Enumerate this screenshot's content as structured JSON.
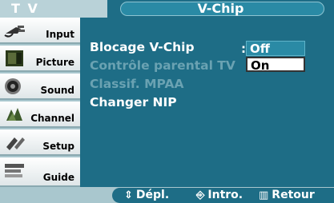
{
  "header": {
    "menu_title": "T V",
    "screen_title": "V-Chip"
  },
  "sidebar": {
    "items": [
      {
        "label": "Input",
        "icon": "input-plug-icon"
      },
      {
        "label": "Picture",
        "icon": "picture-icon"
      },
      {
        "label": "Sound",
        "icon": "speaker-icon"
      },
      {
        "label": "Channel",
        "icon": "channel-icon"
      },
      {
        "label": "Setup",
        "icon": "setup-icon"
      },
      {
        "label": "Guide",
        "icon": "guide-icon"
      }
    ]
  },
  "menu": {
    "items": [
      {
        "label": "Blocage V-Chip",
        "state": "active"
      },
      {
        "label": "Contrôle parental TV",
        "state": "disabled"
      },
      {
        "label": "Classif. MPAA",
        "state": "disabled"
      },
      {
        "label": "Changer NIP",
        "state": "enabled"
      }
    ],
    "separator": ":",
    "options": [
      {
        "label": "Off",
        "selected": true
      },
      {
        "label": "On",
        "selected": false
      }
    ]
  },
  "footer": {
    "move": "Dépl.",
    "enter": "Intro.",
    "return": "Retour"
  },
  "colors": {
    "panel": "#1e6d86",
    "frame": "#a9c7ce",
    "highlight": "#2a8aa5"
  }
}
